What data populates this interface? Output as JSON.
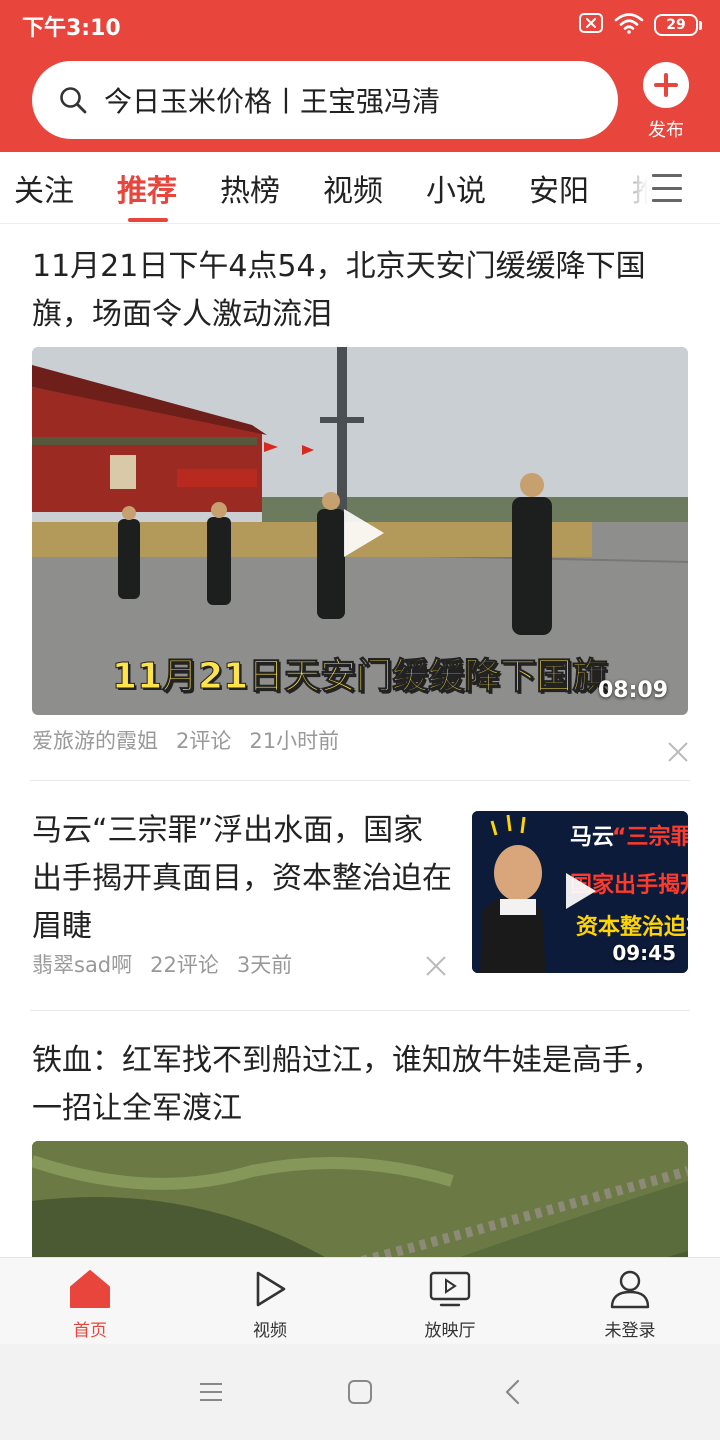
{
  "status_bar": {
    "time": "下午3:10",
    "battery": "29",
    "icons": [
      "sim-card-icon",
      "wifi-icon",
      "battery-icon"
    ]
  },
  "search": {
    "text": "今日玉米价格丨王宝强冯清",
    "icon": "search-icon"
  },
  "publish": {
    "label": "发布",
    "icon": "plus-icon"
  },
  "tabs": [
    {
      "label": "关注"
    },
    {
      "label": "推荐",
      "active": true
    },
    {
      "label": "热榜"
    },
    {
      "label": "视频"
    },
    {
      "label": "小说"
    },
    {
      "label": "安阳"
    },
    {
      "label": "推"
    }
  ],
  "articles": [
    {
      "title": "11月21日下午4点54，北京天安门缓缓降下国旗，场面令人激动流泪",
      "caption": "11月21日天安门缓缓降下国旗",
      "duration": "08:09",
      "author": "爱旅游的霞姐",
      "comments": "2评论",
      "time": "21小时前"
    },
    {
      "title": "马云“三宗罪”浮出水面，国家出手揭开真面目，资本整治迫在眉睫",
      "thumb_lines": [
        "马云",
        "“三宗罪”",
        "国家出手揭开",
        "资本整治迫在"
      ],
      "duration": "09:45",
      "author": "翡翠sad啊",
      "comments": "22评论",
      "time": "3天前"
    },
    {
      "title": "铁血：红军找不到船过江，谁知放牛娃是高手，一招让全军渡江"
    }
  ],
  "bottom_nav": [
    {
      "label": "首页",
      "icon": "home-icon",
      "active": true
    },
    {
      "label": "视频",
      "icon": "play-icon"
    },
    {
      "label": "放映厅",
      "icon": "tv-icon"
    },
    {
      "label": "未登录",
      "icon": "user-icon"
    }
  ],
  "colors": {
    "accent": "#e8453c",
    "text": "#222222",
    "meta": "#999999"
  }
}
